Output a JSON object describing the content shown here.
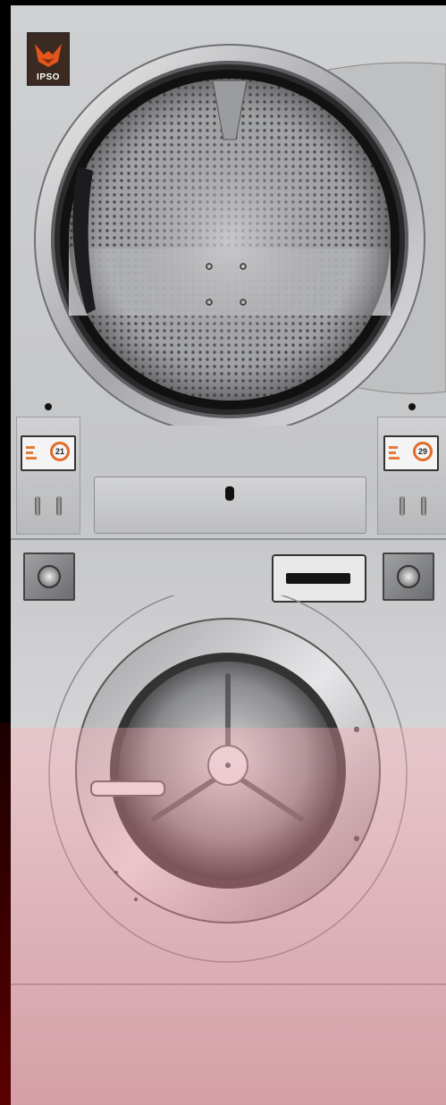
{
  "brand": {
    "name": "IPSO",
    "logo_color": "#e2561b"
  },
  "dryer": {
    "left_display": {
      "timer_value": "21"
    },
    "right_display": {
      "timer_value": "29"
    }
  },
  "colors": {
    "steel": "#c9cacc",
    "display_accent": "#e26b2a",
    "overlay_tint": "#e58f9c"
  }
}
